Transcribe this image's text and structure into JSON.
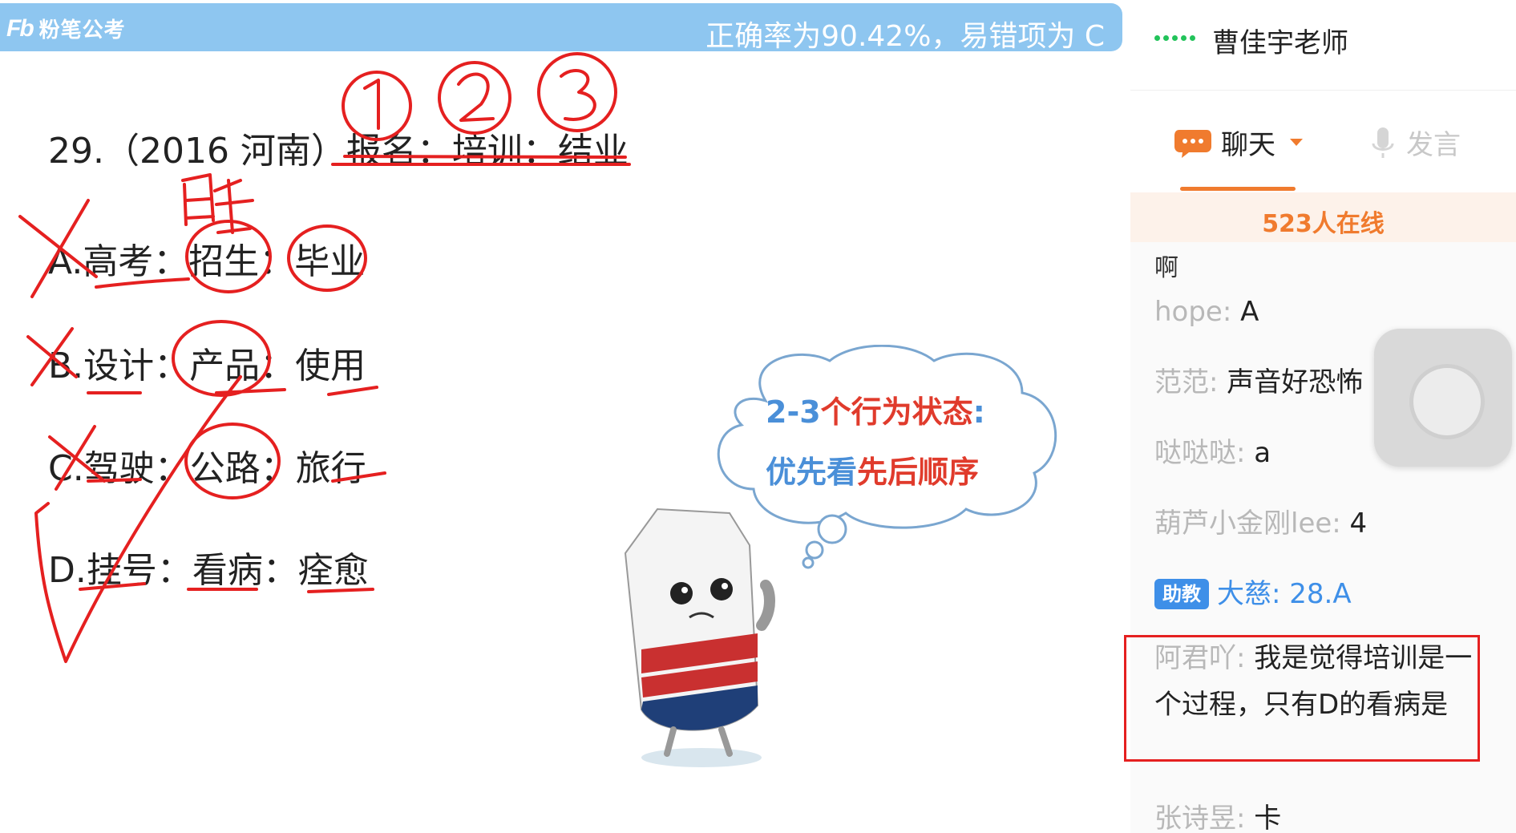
{
  "brand": {
    "logo": "Fb",
    "name": "粉笔公考"
  },
  "stats": {
    "accuracy_text": "正确率为90.42%，易错项为 C"
  },
  "question": {
    "stem": "29.（2016 河南）报名：培训：结业",
    "options": {
      "A": "A.高考：招生：毕业",
      "B": "B.设计：产品：使用",
      "C": "C.驾驶：公路：旅行",
      "D": "D.挂号：看病：痊愈"
    }
  },
  "annotation_bubble": {
    "line1_blue_a": "2-3",
    "line1_red": "个行为状态",
    "line1_blue_b": ":",
    "line2_blue": "优先看",
    "line2_red": "先后顺序"
  },
  "panel": {
    "teacher_name": "曹佳宇老师",
    "tabs": {
      "chat": "聊天",
      "speak": "发言"
    },
    "online_count": "523人在线",
    "messages": [
      {
        "user": "",
        "text": "啊"
      },
      {
        "user": "hope: ",
        "text": "A"
      },
      {
        "user": "范范: ",
        "text": "声音好恐怖"
      },
      {
        "user": "哒哒哒: ",
        "text": "a"
      },
      {
        "user": "葫芦小金刚lee: ",
        "text": "4"
      },
      {
        "badge": "助教",
        "user": "大慈: ",
        "text": "28.A"
      },
      {
        "user": "阿君吖: ",
        "text": "我是觉得培训是一个过程，只有D的看病是"
      },
      {
        "user": "张诗昱: ",
        "text": "卡"
      }
    ]
  },
  "colors": {
    "accent": "#f07b2e",
    "topbar": "#8ec6f0",
    "ink": "#e52020",
    "assistant": "#3e8fe8"
  }
}
